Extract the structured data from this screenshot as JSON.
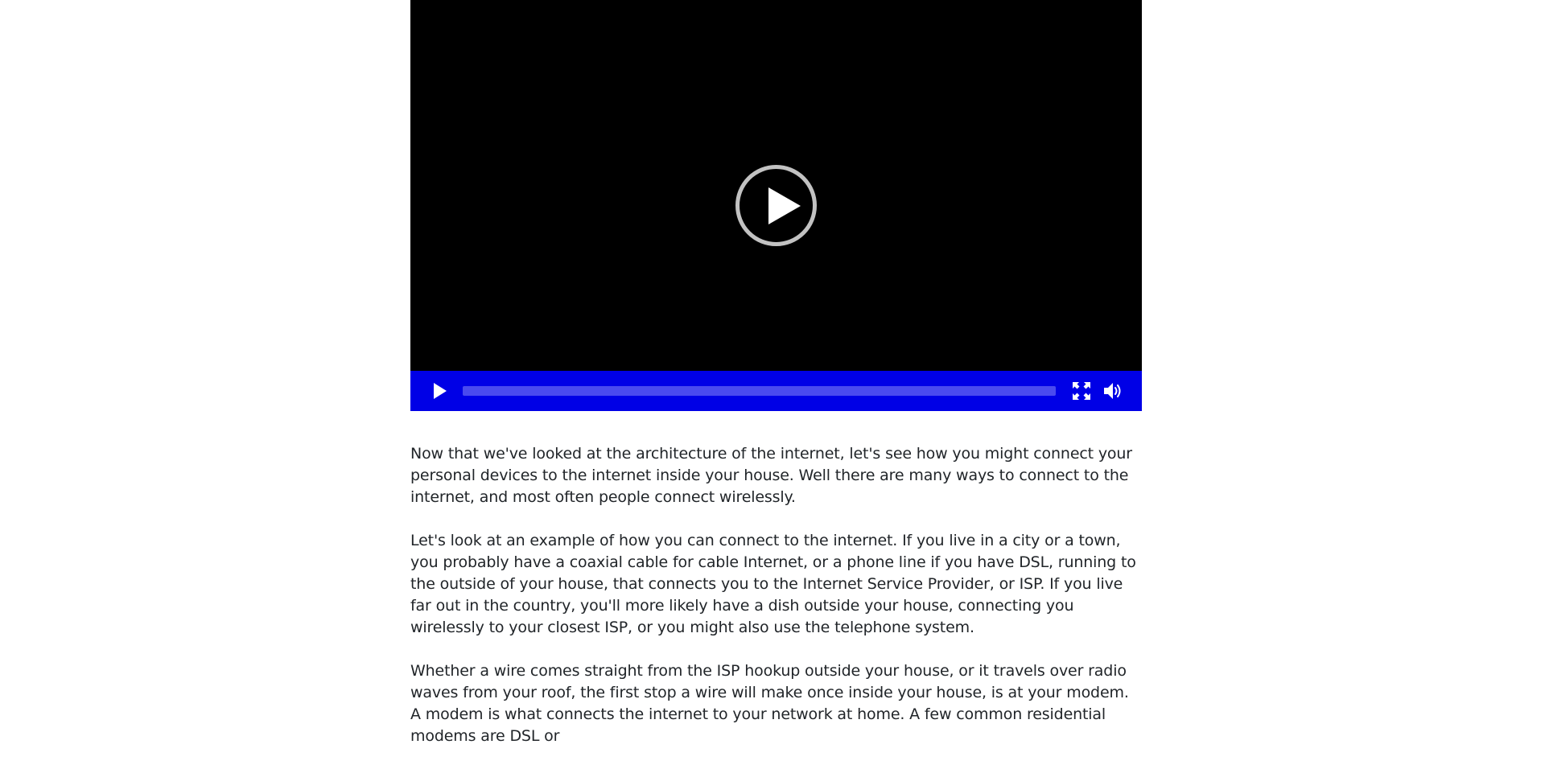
{
  "video": {
    "progress": 0,
    "icons": {
      "big_play": "play-circle-icon",
      "play": "play-icon",
      "fullscreen": "fullscreen-icon",
      "volume": "volume-icon"
    },
    "colors": {
      "screen": "#000000",
      "control_bar": "#0000e6",
      "progress_track": "#4a4aef",
      "icon": "#ffffff",
      "big_play_ring": "#c2c2c2"
    }
  },
  "article": {
    "paragraphs": [
      "Now that we've looked at the architecture of the internet, let's see how you might connect your personal devices to the internet inside your house. Well there are many ways to connect to the internet, and most often people connect wirelessly.",
      "Let's look at an example of how you can connect to the internet. If you live in a city or a town, you probably have a coaxial cable for cable Internet, or a phone line if you have DSL, running to the outside of your house, that connects you to the Internet Service Provider, or ISP. If you live far out in the country, you'll more likely have a dish outside your house, connecting you wirelessly to your closest ISP, or you might also use the telephone system.",
      "Whether a wire comes straight from the ISP hookup outside your house, or it travels over radio waves from your roof, the first stop a wire will make once inside your house, is at your modem. A modem is what connects the internet to your network at home. A few common residential modems are DSL or"
    ],
    "text_color": "#212529"
  }
}
